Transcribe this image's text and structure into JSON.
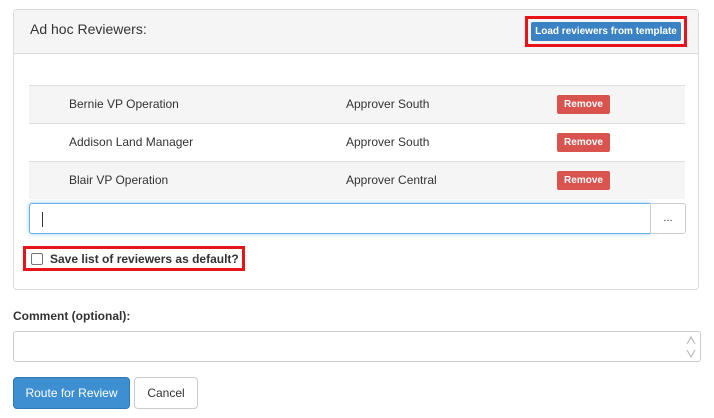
{
  "panel": {
    "title": "Ad hoc Reviewers:",
    "load_button_label": "Load reviewers from template"
  },
  "reviewers": [
    {
      "name": "Bernie VP Operation",
      "role": "Approver South",
      "remove_label": "Remove"
    },
    {
      "name": "Addison Land Manager",
      "role": "Approver South",
      "remove_label": "Remove"
    },
    {
      "name": "Blair VP Operation",
      "role": "Approver Central",
      "remove_label": "Remove"
    }
  ],
  "add_reviewer": {
    "value": "",
    "browse_label": "..."
  },
  "save_default": {
    "label": "Save list of reviewers as default?",
    "checked": false
  },
  "comment": {
    "label": "Comment (optional):",
    "value": ""
  },
  "actions": {
    "route_label": "Route for Review",
    "cancel_label": "Cancel"
  },
  "colors": {
    "primary": "#3d8fd1",
    "danger": "#d9534f",
    "highlight": "#e8141c"
  },
  "icons": {
    "comment_scroll": "up-down-arrows-icon"
  }
}
